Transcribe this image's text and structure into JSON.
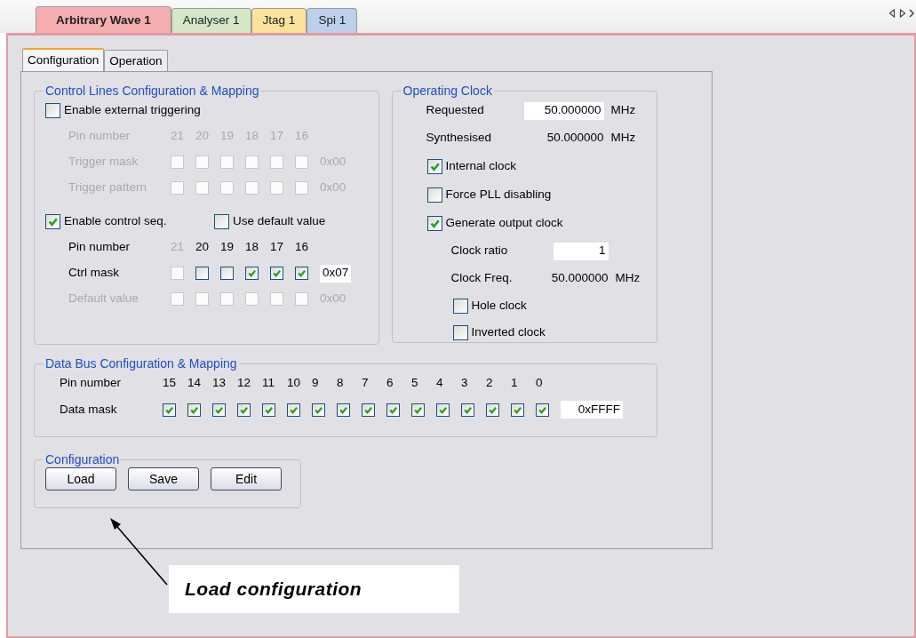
{
  "doc_tabs": [
    {
      "label": "Arbitrary Wave 1",
      "selected": true,
      "color": "#f4aeb0"
    },
    {
      "label": "Analyser 1",
      "selected": false,
      "color": "#d4e8c8"
    },
    {
      "label": "Jtag 1",
      "selected": false,
      "color": "#fbe39c"
    },
    {
      "label": "Spi 1",
      "selected": false,
      "color": "#bcd0ec"
    }
  ],
  "sub_tabs": [
    {
      "label": "Configuration",
      "selected": true
    },
    {
      "label": "Operation",
      "selected": false
    }
  ],
  "control_lines": {
    "title": "Control Lines Configuration & Mapping",
    "external_trigger": {
      "label": "Enable external triggering",
      "checked": false
    },
    "trigger_grid": {
      "pins_label": "Pin number",
      "pins_disabled": true,
      "pins": [
        {
          "text": "21",
          "disabled": true
        },
        {
          "text": "20",
          "disabled": true
        },
        {
          "text": "19",
          "disabled": true
        },
        {
          "text": "18",
          "disabled": true
        },
        {
          "text": "17",
          "disabled": true
        },
        {
          "text": "16",
          "disabled": true
        }
      ],
      "rows": [
        {
          "label": "Trigger mask",
          "disabled": true,
          "value": "0x00",
          "bits": [
            {
              "checked": false,
              "disabled": true
            },
            {
              "checked": false,
              "disabled": true
            },
            {
              "checked": false,
              "disabled": true
            },
            {
              "checked": false,
              "disabled": true
            },
            {
              "checked": false,
              "disabled": true
            },
            {
              "checked": false,
              "disabled": true
            }
          ]
        },
        {
          "label": "Trigger pattern",
          "disabled": true,
          "value": "0x00",
          "bits": [
            {
              "checked": false,
              "disabled": true
            },
            {
              "checked": false,
              "disabled": true
            },
            {
              "checked": false,
              "disabled": true
            },
            {
              "checked": false,
              "disabled": true
            },
            {
              "checked": false,
              "disabled": true
            },
            {
              "checked": false,
              "disabled": true
            }
          ]
        }
      ]
    },
    "control_seq": {
      "label": "Enable control seq.",
      "checked": true
    },
    "use_default": {
      "label": "Use default value",
      "checked": false
    },
    "seq_grid": {
      "pins_label": "Pin number",
      "pins_disabled": false,
      "pins": [
        {
          "text": "21",
          "disabled": true
        },
        {
          "text": "20",
          "disabled": false
        },
        {
          "text": "19",
          "disabled": false
        },
        {
          "text": "18",
          "disabled": false
        },
        {
          "text": "17",
          "disabled": false
        },
        {
          "text": "16",
          "disabled": false
        }
      ],
      "rows": [
        {
          "label": "Ctrl mask",
          "disabled": false,
          "value": "0x07",
          "bits": [
            {
              "checked": false,
              "disabled": true
            },
            {
              "checked": false,
              "disabled": false
            },
            {
              "checked": false,
              "disabled": false
            },
            {
              "checked": true,
              "disabled": false
            },
            {
              "checked": true,
              "disabled": false
            },
            {
              "checked": true,
              "disabled": false
            }
          ]
        },
        {
          "label": "Default value",
          "disabled": true,
          "value": "0x00",
          "bits": [
            {
              "checked": false,
              "disabled": true
            },
            {
              "checked": false,
              "disabled": true
            },
            {
              "checked": false,
              "disabled": true
            },
            {
              "checked": false,
              "disabled": true
            },
            {
              "checked": false,
              "disabled": true
            },
            {
              "checked": false,
              "disabled": true
            }
          ]
        }
      ]
    }
  },
  "operating_clock": {
    "title": "Operating Clock",
    "items": [
      {
        "kind": "field",
        "label": "Requested",
        "value": "50.000000",
        "unit": "MHz"
      },
      {
        "kind": "readout",
        "label": "Synthesised",
        "value": "50.000000",
        "unit": "MHz"
      },
      {
        "kind": "checkbox",
        "label": "Internal clock",
        "checked": true
      },
      {
        "kind": "checkbox",
        "label": "Force PLL disabling",
        "checked": false
      },
      {
        "kind": "checkbox",
        "label": "Generate output clock",
        "checked": true,
        "children": [
          {
            "kind": "field",
            "label": "Clock ratio",
            "value": "1"
          },
          {
            "kind": "readout",
            "label": "Clock Freq.",
            "value": "50.000000",
            "unit": "MHz"
          },
          {
            "kind": "checkbox",
            "label": "Hole clock",
            "checked": false
          },
          {
            "kind": "checkbox",
            "label": "Inverted clock",
            "checked": false
          }
        ]
      }
    ]
  },
  "data_bus": {
    "title": "Data Bus Configuration & Mapping",
    "pins_label": "Pin number",
    "pins": [
      "15",
      "14",
      "13",
      "12",
      "11",
      "10",
      "9",
      "8",
      "7",
      "6",
      "5",
      "4",
      "3",
      "2",
      "1",
      "0"
    ],
    "rows": [
      {
        "label": "Data mask",
        "value": "0xFFFF",
        "bits": [
          {
            "checked": true
          },
          {
            "checked": true
          },
          {
            "checked": true
          },
          {
            "checked": true
          },
          {
            "checked": true
          },
          {
            "checked": true
          },
          {
            "checked": true
          },
          {
            "checked": true
          },
          {
            "checked": true
          },
          {
            "checked": true
          },
          {
            "checked": true
          },
          {
            "checked": true
          },
          {
            "checked": true
          },
          {
            "checked": true
          },
          {
            "checked": true
          },
          {
            "checked": true
          }
        ]
      }
    ]
  },
  "configuration": {
    "title": "Configuration",
    "buttons": [
      "Load",
      "Save",
      "Edit"
    ]
  },
  "callout": {
    "text": "Load configuration"
  }
}
